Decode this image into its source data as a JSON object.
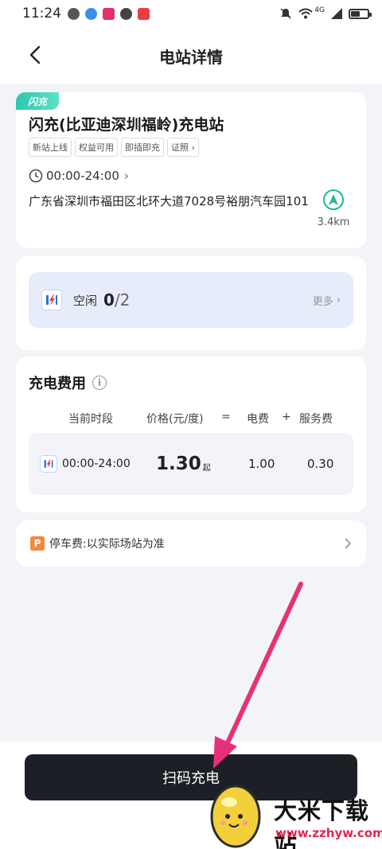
{
  "status_bar": {
    "time": "11:24",
    "network": "4G"
  },
  "header": {
    "title": "电站详情"
  },
  "station": {
    "tag": "闪充",
    "name": "闪充(比亚迪深圳福岭)充电站",
    "tags": [
      "新站上线",
      "权益可用",
      "即插即充",
      "证照"
    ],
    "hours": "00:00-24:00",
    "address": "广东省深圳市福田区北环大道7028号裕朋汽车园101",
    "distance": "3.4km"
  },
  "availability": {
    "label": "空闲",
    "free": "0",
    "total": "/2",
    "more": "更多"
  },
  "fee": {
    "title": "充电费用",
    "headers": {
      "period": "当前时段",
      "price": "价格(元/度)",
      "eq": "=",
      "electric": "电费",
      "plus": "+",
      "service": "服务费"
    },
    "row": {
      "period": "00:00-24:00",
      "price": "1.30",
      "price_suffix": "起",
      "electric": "1.00",
      "service": "0.30"
    }
  },
  "parking": {
    "badge": "P",
    "text": "停车费:以实际场站为准"
  },
  "action": {
    "scan_label": "扫码充电"
  },
  "watermark": {
    "title": "大米下载站",
    "url": "www.zzhyw.com"
  },
  "colors": {
    "accent": "#1fb89c",
    "button": "#1c1f26",
    "arrow": "#e8307a",
    "availability_bg": "#e7ecfb"
  }
}
